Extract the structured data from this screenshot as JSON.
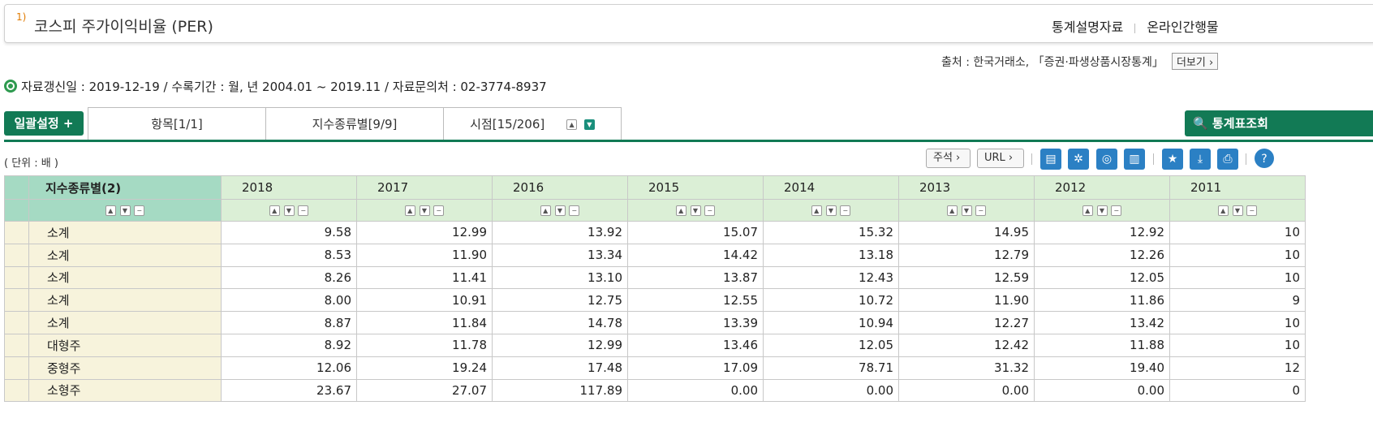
{
  "title": {
    "num": "1)",
    "text": "코스피 주가이익비율 (PER)"
  },
  "links": {
    "stats_doc": "통계설명자료",
    "online": "온라인간행물"
  },
  "source": {
    "text": "출처 : 한국거래소, 「증권·파생상품시장통계」",
    "more": "더보기 ›"
  },
  "info": "자료갱신일 : 2019-12-19 / 수록기간 : 월, 년 2004.01 ~ 2019.11 / 자료문의처 : 02-3774-8937",
  "buttons": {
    "settings": "일괄설정 +",
    "query": "🔍 통계표조회"
  },
  "tabs": [
    {
      "label": "항목[1/1]"
    },
    {
      "label": "지수종류별[9/9]"
    },
    {
      "label": "시점[15/206]"
    }
  ],
  "unit": "( 단위 : 배 )",
  "toolbar": {
    "note": "주석 ›",
    "url": "URL ›"
  },
  "icons": [
    "table-layout-icon",
    "gear-icon",
    "chart-search-icon",
    "bar-chart-icon",
    "star-icon",
    "download-icon",
    "print-icon",
    "help-icon"
  ],
  "table": {
    "dim_header": "지수종류별(2)",
    "years": [
      "2018",
      "2017",
      "2016",
      "2015",
      "2014",
      "2013",
      "2012",
      "2011"
    ],
    "rows": [
      {
        "label": "소계",
        "values": [
          "9.58",
          "12.99",
          "13.92",
          "15.07",
          "15.32",
          "14.95",
          "12.92",
          "10"
        ]
      },
      {
        "label": "소계",
        "values": [
          "8.53",
          "11.90",
          "13.34",
          "14.42",
          "13.18",
          "12.79",
          "12.26",
          "10"
        ]
      },
      {
        "label": "소계",
        "values": [
          "8.26",
          "11.41",
          "13.10",
          "13.87",
          "12.43",
          "12.59",
          "12.05",
          "10"
        ]
      },
      {
        "label": "소계",
        "values": [
          "8.00",
          "10.91",
          "12.75",
          "12.55",
          "10.72",
          "11.90",
          "11.86",
          "9"
        ]
      },
      {
        "label": "소계",
        "values": [
          "8.87",
          "11.84",
          "14.78",
          "13.39",
          "10.94",
          "12.27",
          "13.42",
          "10"
        ]
      },
      {
        "label": "대형주",
        "values": [
          "8.92",
          "11.78",
          "12.99",
          "13.46",
          "12.05",
          "12.42",
          "11.88",
          "10"
        ]
      },
      {
        "label": "중형주",
        "values": [
          "12.06",
          "19.24",
          "17.48",
          "17.09",
          "78.71",
          "31.32",
          "19.40",
          "12"
        ]
      },
      {
        "label": "소형주",
        "values": [
          "23.67",
          "27.07",
          "117.89",
          "0.00",
          "0.00",
          "0.00",
          "0.00",
          "0"
        ]
      }
    ]
  },
  "colors": {
    "accent_green": "#127a55",
    "header_green": "#dbefd6",
    "dim_green": "#a5dac3",
    "label_bg": "#f7f3dc",
    "icon_blue": "#2b80c4"
  }
}
